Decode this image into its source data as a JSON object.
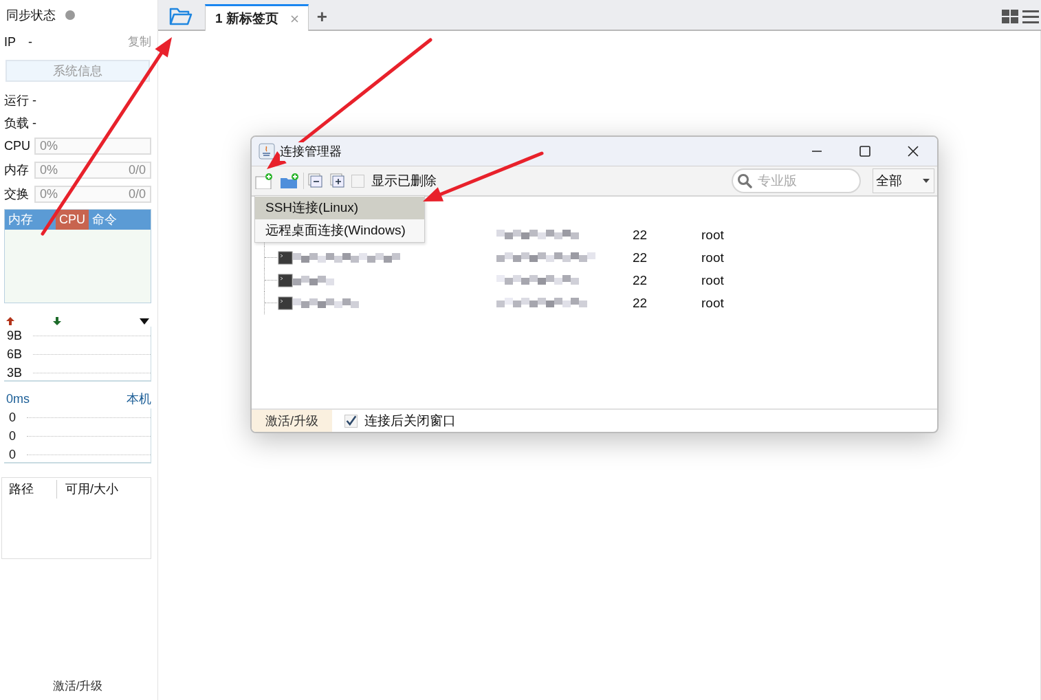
{
  "sidebar": {
    "sync_label": "同步状态",
    "sync_on": false,
    "ip_label": "IP",
    "ip_value": "-",
    "copy": "复制",
    "sysinfo_button": "系统信息",
    "uptime": "运行 -",
    "load": "负载 -",
    "meters": [
      {
        "label": "CPU",
        "percent": "0%"
      },
      {
        "label": "内存",
        "percent": "0%",
        "usage": "0/0"
      },
      {
        "label": "交换",
        "percent": "0%",
        "usage": "0/0"
      }
    ],
    "monitor_tabs": [
      {
        "label": "内存",
        "selected": false
      },
      {
        "label": "CPU",
        "selected": true
      },
      {
        "label": "命令",
        "selected": false
      }
    ],
    "network_ticks": [
      "9B",
      "6B",
      "3B"
    ],
    "latency": "0ms",
    "host": "本机",
    "latency_ticks": [
      "0",
      "0",
      "0"
    ],
    "disk_columns": [
      "路径",
      "可用/大小"
    ],
    "activate": "激活/升级"
  },
  "tabs": [
    {
      "label": "1 新标签页",
      "selected": true
    }
  ],
  "tab_add": "+",
  "dialog": {
    "title": "连接管理器",
    "show_deleted": {
      "label": "显示已删除",
      "checked": false
    },
    "search": {
      "placeholder": "专业版"
    },
    "filter": "全部",
    "menu": [
      {
        "label": "SSH连接(Linux)",
        "selected": true
      },
      {
        "label": "远程桌面连接(Windows)",
        "selected": false
      }
    ],
    "rows": [
      {
        "port": "22",
        "user": "root"
      },
      {
        "port": "22",
        "user": "root"
      },
      {
        "port": "22",
        "user": "root"
      },
      {
        "port": "22",
        "user": "root"
      }
    ],
    "footer": {
      "activate": "激活/升级",
      "close_after": {
        "label": "连接后关闭窗口",
        "checked": true
      }
    }
  }
}
